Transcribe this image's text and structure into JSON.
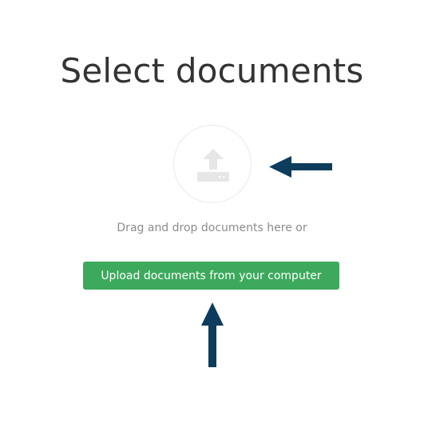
{
  "page": {
    "title": "Select documents"
  },
  "dropzone": {
    "icon": "upload-icon",
    "hint": "Drag and drop documents here or"
  },
  "upload": {
    "button_label": "Upload documents from your computer",
    "button_color": "#3ca95c"
  },
  "annotations": {
    "arrow_color": "#0e3c5c"
  }
}
